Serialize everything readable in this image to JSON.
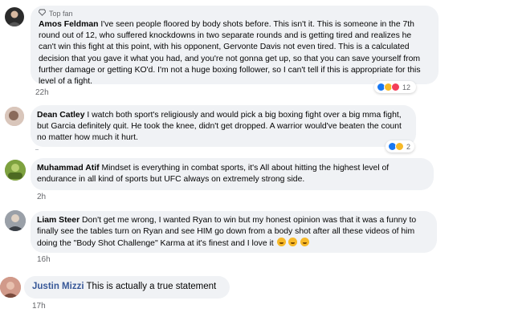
{
  "comments": [
    {
      "author": "Amos Feldman",
      "badge": "Top fan",
      "text": "I've seen people floored by body shots before. This isn't it. This is someone in the 7th round out of 12, who suffered knockdowns in two separate rounds and is getting tired and realizes he can't win this fight at this point, with his opponent, Gervonte Davis not even tired. This is a calculated decision that you gave it what you had, and you're not gonna get up, so that you can save yourself from further damage or getting KO'd. I'm not a huge boxing follower, so I can't tell if this is appropriate for this level of a fight.",
      "time": "22h",
      "reactions": {
        "count": "12",
        "icons": [
          "like-icon",
          "haha-icon",
          "love-icon"
        ]
      },
      "avatar_color": "#2b2b2b"
    },
    {
      "author": "Dean Catley",
      "text": "I watch both sport's religiously and would pick a big boxing fight over a big mma fight, but Garcia definitely quit. He took the knee, didn't get dropped. A warrior would've beaten the count no matter how much it hurt.",
      "reactions": {
        "count": "2",
        "icons": [
          "like-icon",
          "haha-icon"
        ]
      },
      "avatar_color": "#c9a99a"
    },
    {
      "author": "Muhammad Atif",
      "text": "Mindset is everything in combat sports, it's All about hitting the highest level of endurance in all kind of sports but UFC always on extremely strong side.",
      "time": "2h",
      "avatar_color": "#6f8f3a"
    },
    {
      "author": "Liam Steer",
      "text": "Don't get me wrong, I wanted Ryan to win but my honest opinion was that it was a funny to finally see the tables turn on Ryan and see HIM go down from a body shot after all these videos of him doing the \"Body Shot Challenge\" Karma at it's finest and I love it",
      "time": "16h",
      "avatar_color": "#8a8f98"
    },
    {
      "author": "Justin Mizzi",
      "text": "This is actually a true statement",
      "time": "17h",
      "avatar_color": "#c98a7a"
    }
  ]
}
